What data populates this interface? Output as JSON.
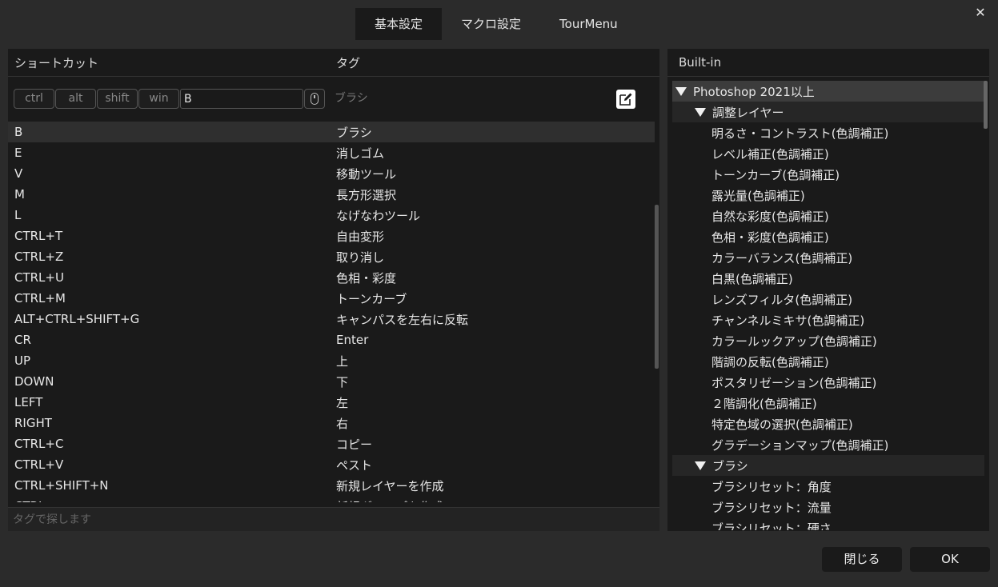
{
  "tabs": [
    {
      "label": "基本設定",
      "active": true
    },
    {
      "label": "マクロ設定",
      "active": false
    },
    {
      "label": "TourMenu",
      "active": false
    }
  ],
  "close_glyph": "✕",
  "left": {
    "headers": {
      "shortcut": "ショートカット",
      "tag": "タグ"
    },
    "modifiers": {
      "ctrl": "ctrl",
      "alt": "alt",
      "shift": "shift",
      "win": "win"
    },
    "key_value": "B",
    "tag_preview": "ブラシ",
    "rows": [
      {
        "shortcut": "B",
        "tag": "ブラシ",
        "selected": true
      },
      {
        "shortcut": "E",
        "tag": "消しゴム"
      },
      {
        "shortcut": "V",
        "tag": "移動ツール"
      },
      {
        "shortcut": "M",
        "tag": "長方形選択"
      },
      {
        "shortcut": "L",
        "tag": "なげなわツール"
      },
      {
        "shortcut": "CTRL+T",
        "tag": "自由変形"
      },
      {
        "shortcut": "CTRL+Z",
        "tag": "取り消し"
      },
      {
        "shortcut": "CTRL+U",
        "tag": "色相・彩度"
      },
      {
        "shortcut": "CTRL+M",
        "tag": "トーンカーブ"
      },
      {
        "shortcut": "ALT+CTRL+SHIFT+G",
        "tag": "キャンパスを左右に反転"
      },
      {
        "shortcut": "CR",
        "tag": "Enter"
      },
      {
        "shortcut": "UP",
        "tag": "上"
      },
      {
        "shortcut": "DOWN",
        "tag": "下"
      },
      {
        "shortcut": "LEFT",
        "tag": "左"
      },
      {
        "shortcut": "RIGHT",
        "tag": "右"
      },
      {
        "shortcut": "CTRL+C",
        "tag": "コピー"
      },
      {
        "shortcut": "CTRL+V",
        "tag": "ペスト"
      },
      {
        "shortcut": "CTRL+SHIFT+N",
        "tag": "新規レイヤーを作成"
      },
      {
        "shortcut": "CTRL+...",
        "tag": "新規グループを作成"
      }
    ],
    "search_placeholder": "タグで探します"
  },
  "right": {
    "header": "Built-in",
    "tree": [
      {
        "level": 0,
        "label": "Photoshop 2021以上",
        "expanded": true
      },
      {
        "level": 1,
        "label": "調整レイヤー",
        "expanded": true
      },
      {
        "level": 2,
        "label": "明るさ・コントラスト(色調補正)"
      },
      {
        "level": 2,
        "label": "レベル補正(色調補正)"
      },
      {
        "level": 2,
        "label": "トーンカーブ(色調補正)"
      },
      {
        "level": 2,
        "label": "露光量(色調補正)"
      },
      {
        "level": 2,
        "label": "自然な彩度(色調補正)"
      },
      {
        "level": 2,
        "label": "色相・彩度(色調補正)"
      },
      {
        "level": 2,
        "label": "カラーバランス(色調補正)"
      },
      {
        "level": 2,
        "label": "白黒(色調補正)"
      },
      {
        "level": 2,
        "label": "レンズフィルタ(色調補正)"
      },
      {
        "level": 2,
        "label": "チャンネルミキサ(色調補正)"
      },
      {
        "level": 2,
        "label": "カラールックアップ(色調補正)"
      },
      {
        "level": 2,
        "label": "階調の反転(色調補正)"
      },
      {
        "level": 2,
        "label": "ポスタリゼーション(色調補正)"
      },
      {
        "level": 2,
        "label": "２階調化(色調補正)"
      },
      {
        "level": 2,
        "label": "特定色域の選択(色調補正)"
      },
      {
        "level": 2,
        "label": "グラデーションマップ(色調補正)"
      },
      {
        "level": 1,
        "label": "ブラシ",
        "expanded": true
      },
      {
        "level": 2,
        "label": "ブラシリセット：角度"
      },
      {
        "level": 2,
        "label": "ブラシリセット：流量"
      },
      {
        "level": 2,
        "label": "ブラシリセット：硬さ"
      }
    ]
  },
  "buttons": {
    "close": "閉じる",
    "ok": "OK"
  }
}
